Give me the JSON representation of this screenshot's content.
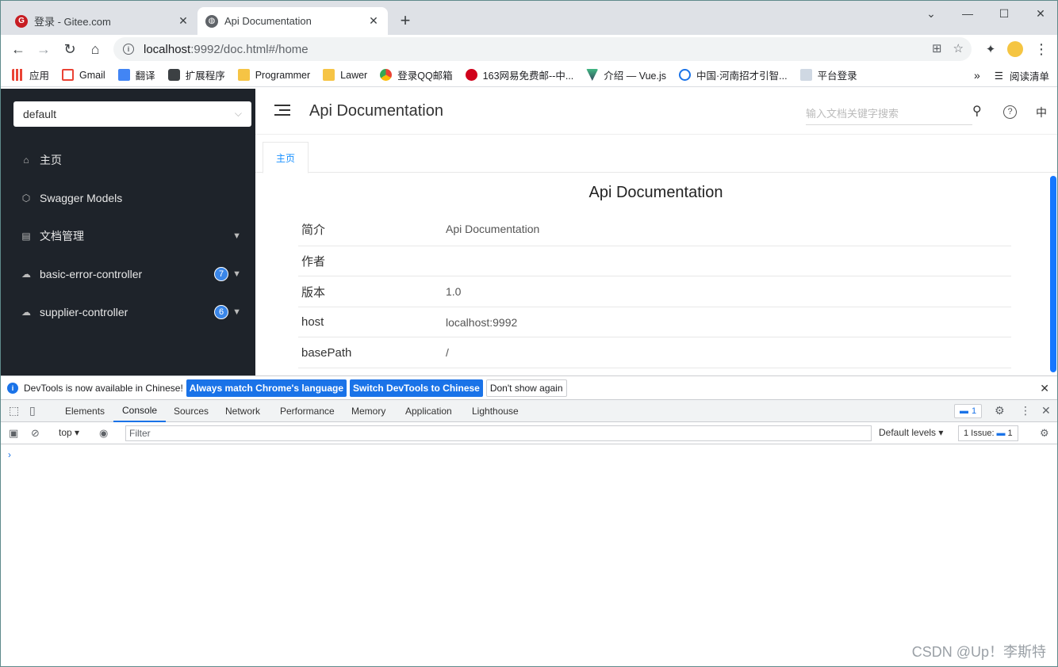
{
  "browser": {
    "tabs": [
      {
        "title": "登录 - Gitee.com",
        "favicon": "gitee-icon",
        "active": false
      },
      {
        "title": "Api Documentation",
        "favicon": "globe-icon",
        "active": true
      }
    ],
    "url": "localhost:9992/doc.html#/home",
    "url_host": "localhost",
    "url_rest": ":9992/doc.html#/home",
    "bookmarks": [
      {
        "label": "应用",
        "icon": "apps-grid-icon"
      },
      {
        "label": "Gmail",
        "icon": "gmail-icon"
      },
      {
        "label": "翻译",
        "icon": "translate-icon"
      },
      {
        "label": "扩展程序",
        "icon": "extensions-icon"
      },
      {
        "label": "Programmer",
        "icon": "folder-icon"
      },
      {
        "label": "Lawer",
        "icon": "folder-icon"
      },
      {
        "label": "登录QQ邮箱",
        "icon": "chrome-icon"
      },
      {
        "label": "163网易免费邮--中...",
        "icon": "163-icon"
      },
      {
        "label": "介绍 — Vue.js",
        "icon": "vue-icon"
      },
      {
        "label": "中国·河南招才引智...",
        "icon": "site-icon"
      },
      {
        "label": "平台登录",
        "icon": "page-icon"
      }
    ],
    "bookmarks_more": "»",
    "reading_list": "阅读清单"
  },
  "sidebar": {
    "group_select": "default",
    "items": [
      {
        "label": "主页",
        "icon": "home-icon",
        "badge": "",
        "has_arrow": false
      },
      {
        "label": "Swagger Models",
        "icon": "cube-icon",
        "badge": "",
        "has_arrow": false
      },
      {
        "label": "文档管理",
        "icon": "doc-icon",
        "badge": "",
        "has_arrow": true
      },
      {
        "label": "basic-error-controller",
        "icon": "cloud-icon",
        "badge": "7",
        "has_arrow": true
      },
      {
        "label": "supplier-controller",
        "icon": "cloud-icon",
        "badge": "6",
        "has_arrow": true
      }
    ]
  },
  "header": {
    "title": "Api Documentation",
    "search_placeholder": "输入文档关键字搜索",
    "lang": "中"
  },
  "page_tabs": [
    "主页"
  ],
  "doc": {
    "title": "Api Documentation",
    "rows": [
      {
        "key": "简介",
        "value": "Api Documentation"
      },
      {
        "key": "作者",
        "value": ""
      },
      {
        "key": "版本",
        "value": "1.0"
      },
      {
        "key": "host",
        "value": "localhost:9992"
      },
      {
        "key": "basePath",
        "value": "/"
      }
    ]
  },
  "devtools": {
    "infobar_text": "DevTools is now available in Chinese!",
    "btn_match": "Always match Chrome's language",
    "btn_switch": "Switch DevTools to Chinese",
    "btn_dont": "Don't show again",
    "tabs": [
      "Elements",
      "Console",
      "Sources",
      "Network",
      "Performance",
      "Memory",
      "Application",
      "Lighthouse"
    ],
    "active_tab": "Console",
    "message_count": "1",
    "context": "top",
    "filter_placeholder": "Filter",
    "levels": "Default levels",
    "issues": "1 Issue:",
    "issues_count": "1",
    "prompt": "›"
  },
  "watermark": "CSDN @Up！李斯特"
}
